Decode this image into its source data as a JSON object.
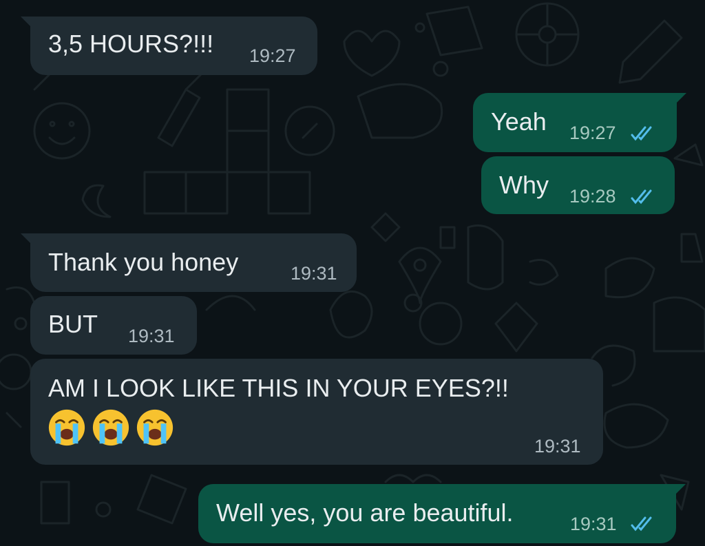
{
  "chat": {
    "messages": [
      {
        "direction": "incoming",
        "text": "3,5 HOURS?!!!",
        "time": "19:27"
      },
      {
        "direction": "outgoing",
        "text": "Yeah",
        "time": "19:27",
        "status": "read"
      },
      {
        "direction": "outgoing",
        "text": "Why",
        "time": "19:28",
        "status": "read"
      },
      {
        "direction": "incoming",
        "text": "Thank you honey",
        "time": "19:31"
      },
      {
        "direction": "incoming",
        "text": "BUT",
        "time": "19:31"
      },
      {
        "direction": "incoming",
        "text": "AM I LOOK LIKE THIS IN YOUR EYES?!!",
        "time": "19:31",
        "emojis": [
          "loudly-crying-face",
          "loudly-crying-face",
          "loudly-crying-face"
        ]
      },
      {
        "direction": "outgoing",
        "text": "Well yes, you are beautiful.",
        "time": "19:31",
        "status": "read"
      }
    ]
  },
  "colors": {
    "background": "#0c1317",
    "incoming_bubble": "#202c33",
    "outgoing_bubble": "#0a5544",
    "read_tick": "#53bdeb",
    "text": "#e9edef"
  }
}
